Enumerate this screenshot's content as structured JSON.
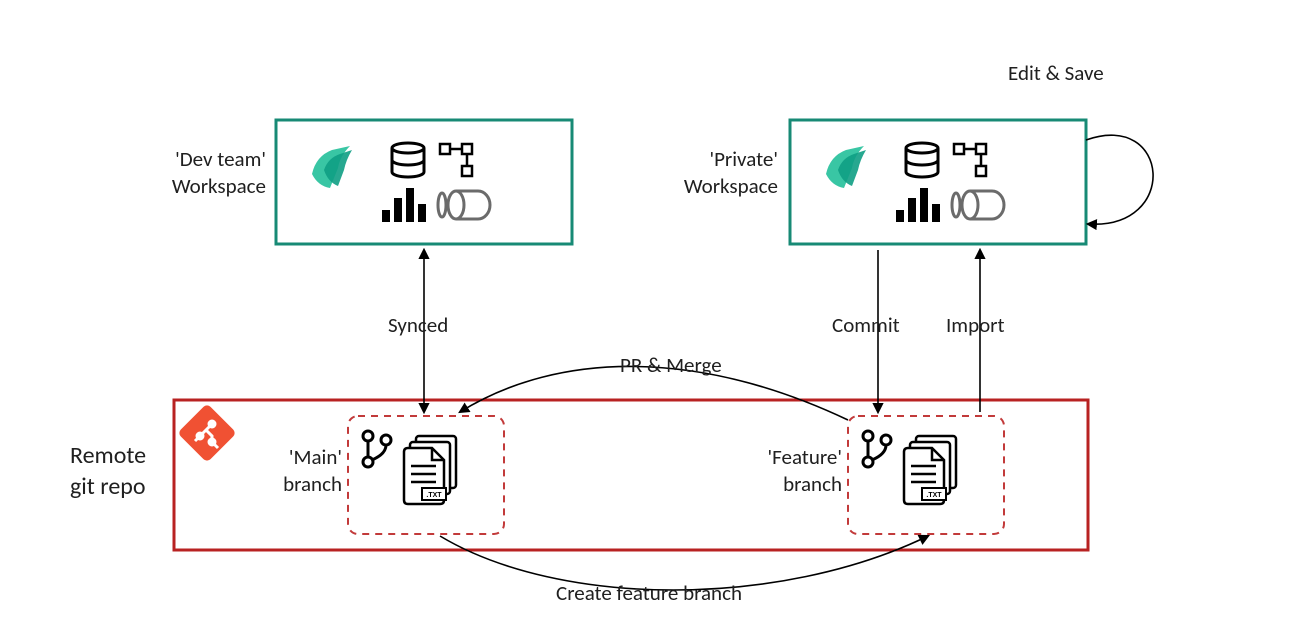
{
  "workspaces": {
    "dev": {
      "label": "'Dev team'\nWorkspace"
    },
    "private": {
      "label": "'Private'\nWorkspace"
    }
  },
  "repo": {
    "title": "Remote\ngit repo",
    "branches": {
      "main": {
        "label": "'Main'\nbranch"
      },
      "feature": {
        "label": "'Feature'\nbranch"
      }
    }
  },
  "arrows": {
    "synced": "Synced",
    "pr_merge": "PR & Merge",
    "commit": "Commit",
    "import": "Import",
    "edit_save": "Edit & Save",
    "create_branch": "Create feature branch"
  }
}
